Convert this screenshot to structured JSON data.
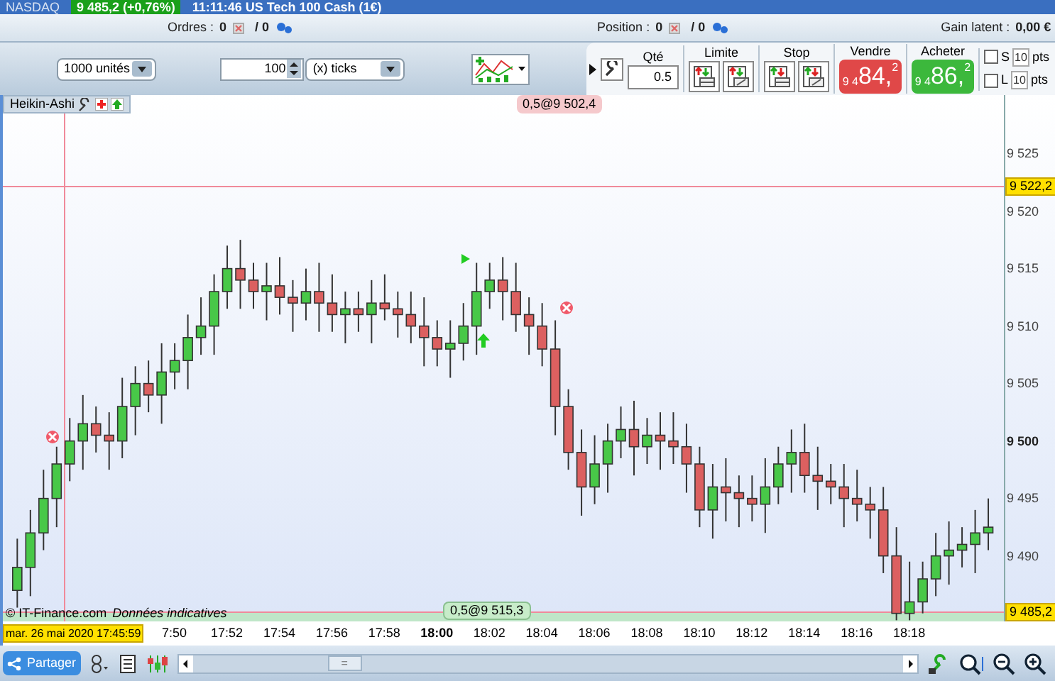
{
  "title_bar": {
    "instrument": "NASDAQ",
    "price_badge": "9 485,2 (+0,76%)",
    "title": "11:11:46 US Tech 100 Cash (1€)"
  },
  "info_row": [
    {
      "label": "Ordres :",
      "count": "0",
      "total": "/ 0"
    },
    {
      "label": "Position :",
      "count": "0",
      "total": "/ 0"
    },
    {
      "label": "Gain latent :",
      "value": "0,00 €"
    }
  ],
  "toolbar": {
    "quantity_select": "1000 unités",
    "ticks_value": "100",
    "ticks_select": "(x) ticks",
    "qty": {
      "label": "Qté",
      "value": "0.5"
    },
    "limit": {
      "label": "Limite"
    },
    "stop": {
      "label": "Stop"
    },
    "sell": {
      "label": "Vendre",
      "prefix": "9 4",
      "big": "84,",
      "suffix": "2"
    },
    "buy": {
      "label": "Acheter",
      "prefix": "9 4",
      "big": "86,",
      "suffix": "2"
    },
    "options": [
      {
        "label": "S",
        "value": "10",
        "unit": "pts",
        "checked": false
      },
      {
        "label": "L",
        "value": "10",
        "unit": "pts",
        "checked": false
      }
    ]
  },
  "chart": {
    "order_top": "0,5@9 502,4",
    "order_bottom": "0,5@9 515,3",
    "copyright": "© IT-Finance.com",
    "disclaimer": "Données indicatives",
    "date_label": "mar. 26 mai 2020 17:45:59",
    "bold_yticks": [
      false,
      false,
      false,
      false,
      false,
      true,
      false,
      false
    ],
    "partial_tick_label": "7:50",
    "bold_xticks": [
      false,
      false,
      false,
      false,
      true,
      false,
      false,
      false,
      false,
      false,
      false,
      false,
      false,
      false
    ],
    "chart_data": {
      "type": "candlestick",
      "title": "Heikin-Ashi",
      "xlim": [
        1063.68,
        1103.88
      ],
      "ref_lines": [
        {
          "axis": "y",
          "value": 9522.2,
          "label": "9 522,2"
        },
        {
          "axis": "y",
          "value": 9485.2,
          "label": "9 485,2"
        },
        {
          "axis": "x",
          "value": 1065.98333
        }
      ],
      "bands": [
        {
          "axis": "y",
          "from": 9484.3,
          "to": 9485.2
        }
      ],
      "ylim": [
        9484.3,
        9530.1
      ],
      "yticks": [
        {
          "value": 9525,
          "label": "9 525"
        },
        {
          "value": 9520,
          "label": "9 520"
        },
        {
          "value": 9515,
          "label": "9 515"
        },
        {
          "value": 9510,
          "label": "9 510"
        },
        {
          "value": 9505,
          "label": "9 505"
        },
        {
          "value": 9500,
          "label": "9 500"
        },
        {
          "value": 9495,
          "label": "9 495"
        },
        {
          "value": 9490,
          "label": "9 490"
        }
      ],
      "xticks": [
        {
          "value": 1072,
          "label": "17:52"
        },
        {
          "value": 1074,
          "label": "17:54"
        },
        {
          "value": 1076,
          "label": "17:56"
        },
        {
          "value": 1078,
          "label": "17:58"
        },
        {
          "value": 1080,
          "label": "18:00"
        },
        {
          "value": 1082,
          "label": "18:02"
        },
        {
          "value": 1084,
          "label": "18:04"
        },
        {
          "value": 1086,
          "label": "18:06"
        },
        {
          "value": 1088,
          "label": "18:08"
        },
        {
          "value": 1090,
          "label": "18:10"
        },
        {
          "value": 1092,
          "label": "18:12"
        },
        {
          "value": 1094,
          "label": "18:14"
        },
        {
          "value": 1096,
          "label": "18:16"
        },
        {
          "value": 1098,
          "label": "18:18"
        }
      ],
      "x": [
        1064,
        1064.5,
        1065,
        1065.5,
        1066,
        1066.5,
        1067,
        1067.5,
        1068,
        1068.5,
        1069,
        1069.5,
        1070,
        1070.5,
        1071,
        1071.5,
        1072,
        1072.5,
        1073,
        1073.5,
        1074,
        1074.5,
        1075,
        1075.5,
        1076,
        1076.5,
        1077,
        1077.5,
        1078,
        1078.5,
        1079,
        1079.5,
        1080,
        1080.5,
        1081,
        1081.5,
        1082,
        1082.5,
        1083,
        1083.5,
        1084,
        1084.5,
        1085,
        1085.5,
        1086,
        1086.5,
        1087,
        1087.5,
        1088,
        1088.5,
        1089,
        1089.5,
        1090,
        1090.5,
        1091,
        1091.5,
        1092,
        1092.5,
        1093,
        1093.5,
        1094,
        1094.5,
        1095,
        1095.5,
        1096,
        1096.5,
        1097,
        1097.5,
        1098,
        1098.5,
        1099,
        1099.5,
        1100,
        1100.5,
        1101
      ],
      "ohlc": [
        [
          9487,
          9491.5,
          9485.5,
          9489
        ],
        [
          9489,
          9494,
          9486.5,
          9492
        ],
        [
          9492,
          9497.5,
          9490.5,
          9495
        ],
        [
          9495,
          9499.5,
          9492.5,
          9498
        ],
        [
          9498,
          9502,
          9496.5,
          9500
        ],
        [
          9500,
          9504,
          9497.5,
          9501.5
        ],
        [
          9501.5,
          9503,
          9499,
          9500.5
        ],
        [
          9500.5,
          9502.5,
          9497.5,
          9500
        ],
        [
          9500,
          9505.5,
          9498.5,
          9503
        ],
        [
          9503,
          9506.5,
          9500.5,
          9505
        ],
        [
          9505,
          9507,
          9502.5,
          9504
        ],
        [
          9504,
          9508.5,
          9501.5,
          9506
        ],
        [
          9506,
          9508.5,
          9504.5,
          9507
        ],
        [
          9507,
          9511,
          9504.5,
          9509
        ],
        [
          9509,
          9512.5,
          9507.5,
          9510
        ],
        [
          9510,
          9514.5,
          9507.5,
          9513
        ],
        [
          9513,
          9517,
          9511.5,
          9515
        ],
        [
          9515,
          9517.5,
          9511.5,
          9514
        ],
        [
          9514,
          9515.5,
          9511.5,
          9513
        ],
        [
          9513,
          9515.5,
          9510.5,
          9513.5
        ],
        [
          9513.5,
          9516,
          9511,
          9512.5
        ],
        [
          9512.5,
          9514,
          9509.5,
          9512
        ],
        [
          9512,
          9515,
          9510.5,
          9513
        ],
        [
          9513,
          9515.5,
          9509.5,
          9512
        ],
        [
          9512,
          9514.5,
          9509.5,
          9511
        ],
        [
          9511,
          9513,
          9508.5,
          9511.5
        ],
        [
          9511.5,
          9513,
          9509.5,
          9511
        ],
        [
          9511,
          9514,
          9508.5,
          9512
        ],
        [
          9512,
          9514.5,
          9510.5,
          9511.5
        ],
        [
          9511.5,
          9513,
          9509,
          9511
        ],
        [
          9511,
          9513,
          9508.5,
          9510
        ],
        [
          9510,
          9512.5,
          9506.5,
          9509
        ],
        [
          9509,
          9510.5,
          9506.5,
          9508
        ],
        [
          9508,
          9510.5,
          9505.5,
          9508.5
        ],
        [
          9508.5,
          9512,
          9507,
          9510
        ],
        [
          9510,
          9515.5,
          9507.5,
          9513
        ],
        [
          9513,
          9515.5,
          9511.5,
          9514
        ],
        [
          9514,
          9516,
          9510.5,
          9513
        ],
        [
          9513,
          9515.5,
          9509.5,
          9511
        ],
        [
          9511,
          9512.5,
          9507.5,
          9510
        ],
        [
          9510,
          9512,
          9506.5,
          9508
        ],
        [
          9508,
          9510.5,
          9500.5,
          9503
        ],
        [
          9503,
          9504.5,
          9497.5,
          9499
        ],
        [
          9499,
          9501,
          9493.5,
          9496
        ],
        [
          9496,
          9500.5,
          9494.5,
          9498
        ],
        [
          9498,
          9501.5,
          9495.5,
          9500
        ],
        [
          9500,
          9503,
          9498.5,
          9501
        ],
        [
          9501,
          9503.5,
          9497,
          9499.5
        ],
        [
          9499.5,
          9502,
          9498,
          9500.5
        ],
        [
          9500.5,
          9502.5,
          9497.5,
          9500
        ],
        [
          9500,
          9502.5,
          9498,
          9499.5
        ],
        [
          9499.5,
          9501.5,
          9495.5,
          9498
        ],
        [
          9498,
          9499.5,
          9492.5,
          9494
        ],
        [
          9494,
          9498,
          9491.5,
          9496
        ],
        [
          9496,
          9498.5,
          9493,
          9495.5
        ],
        [
          9495.5,
          9497,
          9492.5,
          9495
        ],
        [
          9495,
          9497,
          9493,
          9494.5
        ],
        [
          9494.5,
          9498.5,
          9492,
          9496
        ],
        [
          9496,
          9499.5,
          9494.5,
          9498
        ],
        [
          9498,
          9501,
          9495.5,
          9499
        ],
        [
          9499,
          9501.5,
          9495.5,
          9497
        ],
        [
          9497,
          9499.5,
          9494,
          9496.5
        ],
        [
          9496.5,
          9498,
          9494.5,
          9496
        ],
        [
          9496,
          9498,
          9492.5,
          9495
        ],
        [
          9495,
          9497.5,
          9493,
          9494.5
        ],
        [
          9494.5,
          9496,
          9491.5,
          9494
        ],
        [
          9494,
          9496,
          9488.5,
          9490
        ],
        [
          9490,
          9492.5,
          9484.4,
          9485
        ],
        [
          9485,
          9489.5,
          9484.4,
          9486
        ],
        [
          9486,
          9489.5,
          9485,
          9488
        ],
        [
          9488,
          9492,
          9486.5,
          9490
        ],
        [
          9490,
          9493,
          9487.5,
          9490.5
        ],
        [
          9490.5,
          9492.5,
          9489,
          9491
        ],
        [
          9491,
          9494,
          9488.5,
          9492
        ],
        [
          9492,
          9495,
          9490.5,
          9492.5
        ]
      ]
    }
  },
  "bottom_bar": {
    "share_button": "Partager",
    "scroll_grip": "="
  }
}
